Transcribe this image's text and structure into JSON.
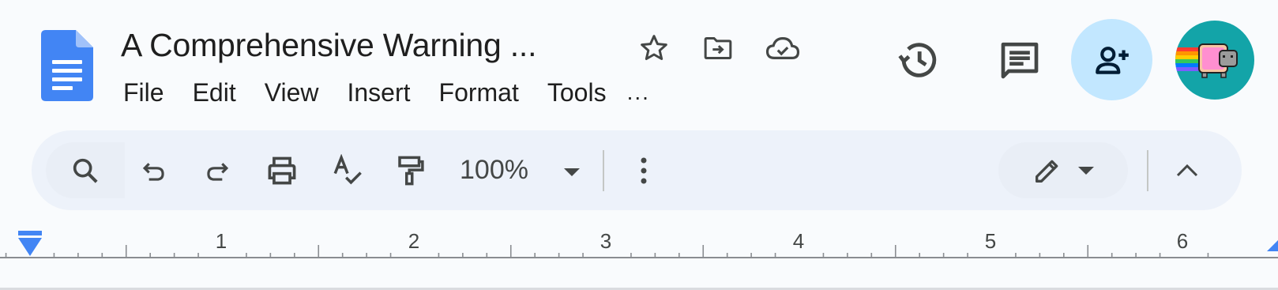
{
  "document": {
    "title": "A Comprehensive Warning ..."
  },
  "menu": {
    "items": [
      "File",
      "Edit",
      "View",
      "Insert",
      "Format",
      "Tools"
    ],
    "more": "..."
  },
  "header_actions": {
    "icons": [
      "star-icon",
      "move-to-folder-icon",
      "cloud-saved-icon",
      "version-history-icon",
      "comments-icon",
      "share-person-add-icon",
      "user-avatar"
    ]
  },
  "toolbar": {
    "zoom": "100%",
    "icons": [
      "search-icon",
      "undo-icon",
      "redo-icon",
      "print-icon",
      "spellcheck-icon",
      "paint-format-icon",
      "more-vert-icon",
      "edit-mode-pencil-icon",
      "collapse-chevron-icon"
    ]
  },
  "ruler": {
    "numbers": [
      "1",
      "2",
      "3",
      "4",
      "5",
      "6"
    ]
  },
  "colors": {
    "accent_blue": "#4285f4",
    "share_bg": "#c2e7ff",
    "toolbar_bg": "#edf2fa",
    "avatar_bg": "#13a4a8"
  }
}
